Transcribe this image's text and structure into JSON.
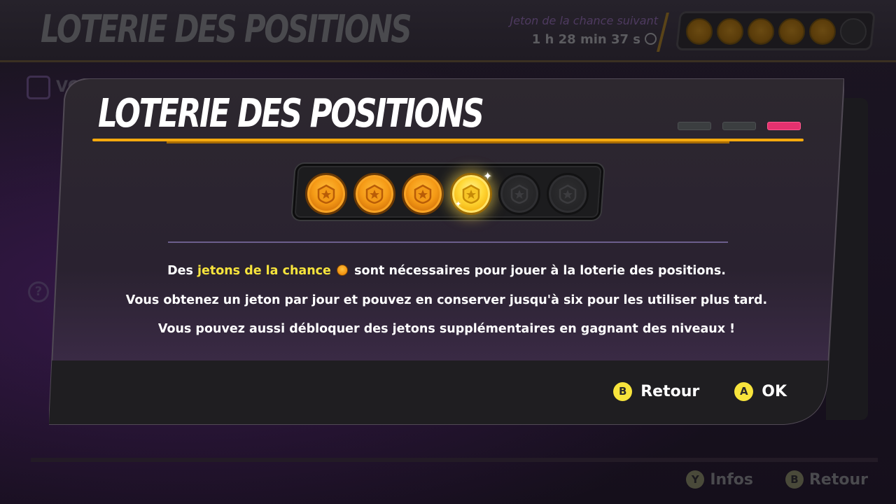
{
  "background": {
    "title": "LOTERIE DES POSITIONS",
    "next_token_label": "Jeton de la chance suivant",
    "next_token_timer": "1 h 28 min 37 s",
    "side_label": "VO",
    "side_icon_2": "?",
    "footer": [
      {
        "key": "Y",
        "label": "Infos"
      },
      {
        "key": "B",
        "label": "Retour"
      }
    ]
  },
  "modal": {
    "title": "LOTERIE DES POSITIONS",
    "page_count": 3,
    "active_page": 3,
    "tokens": {
      "held": 4,
      "max": 6,
      "newest_index": 4
    },
    "message": {
      "line1_before": "Des ",
      "line1_highlight": "jetons de la chance",
      "line1_after": " sont nécessaires pour jouer à la loterie des positions.",
      "line2": "Vous obtenez un jeton par jour et pouvez en conserver jusqu'à six pour les utiliser plus tard.",
      "line3": "Vous pouvez aussi débloquer des jetons supplémentaires en gagnant des niveaux !"
    },
    "actions": [
      {
        "key": "B",
        "label": "Retour"
      },
      {
        "key": "A",
        "label": "OK"
      }
    ]
  },
  "colors": {
    "accent_underline": "#f5a90e",
    "active_page_indicator": "#e5316f",
    "highlight_text": "#f7e43c",
    "button_circle": "#f7e43c"
  },
  "icons": {
    "token": "star-shield-icon",
    "timer": "stopwatch-icon",
    "sparkle": "sparkle-icon"
  }
}
